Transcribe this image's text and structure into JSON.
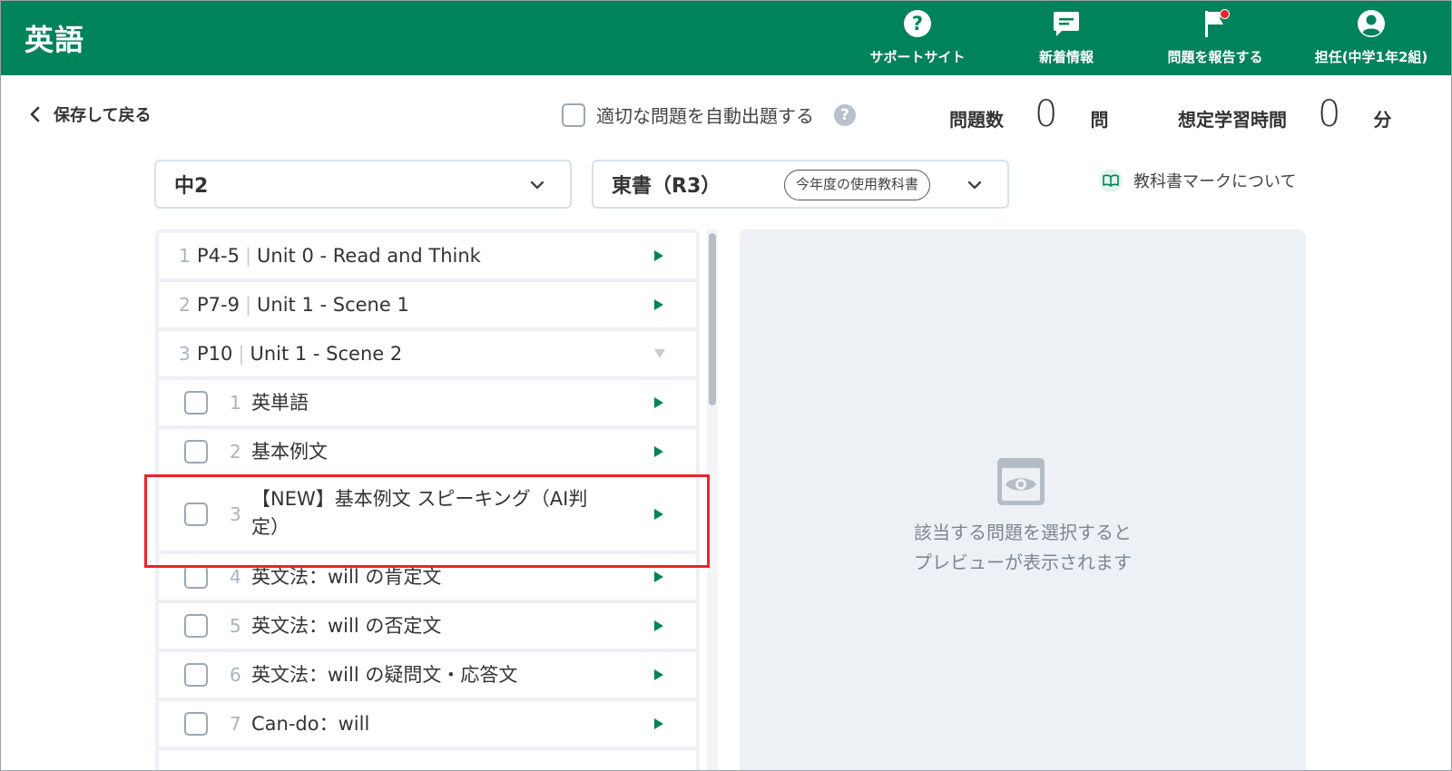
{
  "header": {
    "title": "英語",
    "nav": [
      {
        "label": "サポートサイト",
        "icon": "help-circle-icon"
      },
      {
        "label": "新着情報",
        "icon": "message-icon"
      },
      {
        "label": "問題を報告する",
        "icon": "flag-icon"
      },
      {
        "label": "担任(中学1年2組)",
        "icon": "account-icon"
      }
    ]
  },
  "toolbar": {
    "back_label": "保存して戻る",
    "auto_label": "適切な問題を自動出題する",
    "help_symbol": "?",
    "question_count_label": "問題数",
    "question_count_value": "0",
    "question_count_unit": "問",
    "study_time_label": "想定学習時間",
    "study_time_value": "0",
    "study_time_unit": "分"
  },
  "selects": {
    "grade": "中2",
    "textbook": "東書（R3）",
    "textbook_badge": "今年度の使用教科書",
    "mark_link": "教科書マークについて"
  },
  "list": {
    "units": [
      {
        "num": "1",
        "page": "P4-5",
        "title": "Unit 0 - Read and Think"
      },
      {
        "num": "2",
        "page": "P7-9",
        "title": "Unit 1 - Scene 1"
      },
      {
        "num": "3",
        "page": "P10",
        "title": "Unit 1 - Scene 2"
      }
    ],
    "items": [
      {
        "num": "1",
        "title": "英単語"
      },
      {
        "num": "2",
        "title": "基本例文"
      },
      {
        "num": "3",
        "title": "【NEW】基本例文 スピーキング（AI判",
        "title2": "定）"
      },
      {
        "num": "4",
        "title": "英文法：will の肯定文"
      },
      {
        "num": "5",
        "title": "英文法：will の否定文"
      },
      {
        "num": "6",
        "title": "英文法：will の疑問文・応答文"
      },
      {
        "num": "7",
        "title": "Can-do：will"
      }
    ]
  },
  "preview": {
    "message": "該当する問題を選択すると\nプレビューが表示されます"
  },
  "colors": {
    "brand_green": "#00825a",
    "highlight_red": "#e8262d",
    "panel_bg": "#edf1f5"
  }
}
